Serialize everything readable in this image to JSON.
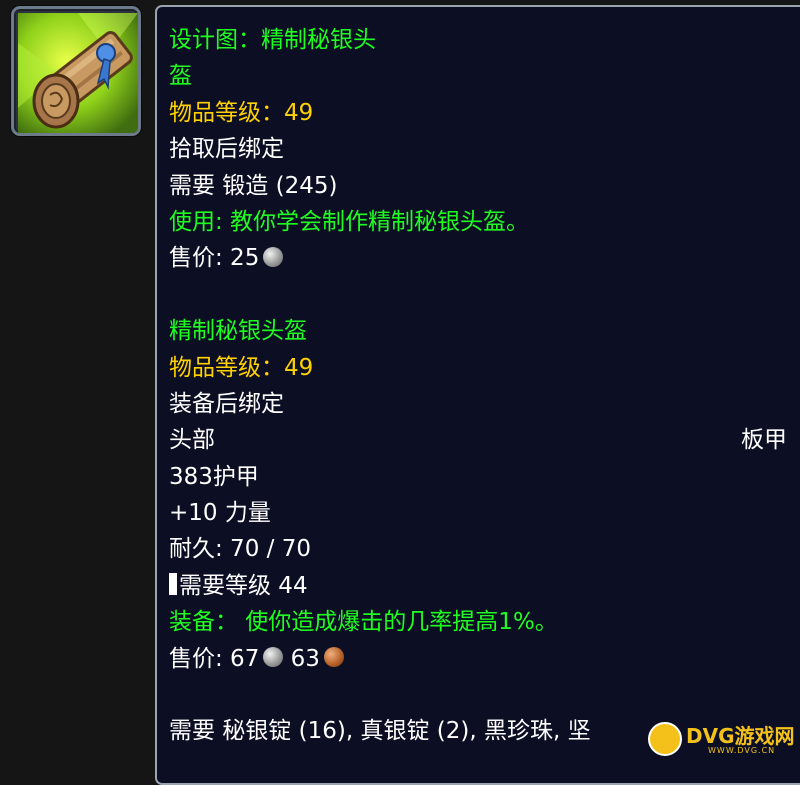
{
  "item_icon": "blueprint-scroll-icon",
  "recipe": {
    "title_line1": "设计图：精制秘银头",
    "title_line2": "盔",
    "item_level": "物品等级：49",
    "binding": "拾取后绑定",
    "requires": "需要 锻造 (245)",
    "use": "使用: 教你学会制作精制秘银头盔。",
    "sell_label": "售价: 25"
  },
  "crafted": {
    "name": "精制秘银头盔",
    "item_level": "物品等级：49",
    "binding": "装备后绑定",
    "slot": "头部",
    "armor_type": "板甲",
    "armor": "383护甲",
    "stat": "+10 力量",
    "durability": "耐久: 70 / 70",
    "required_level": "需要等级 44",
    "equip_effect": "装备： 使你造成爆击的几率提高1%。",
    "sell_label": "售价: 67",
    "sell_copper": "63"
  },
  "reagents": "需要 秘银锭 (16), 真银锭 (2), 黑珍珠, 坚",
  "watermark": {
    "text": "DVG游戏网",
    "sub": "WWW.DVG.CN"
  },
  "colors": {
    "quality_green": "#1fff1f",
    "item_level_yellow": "#ffd100",
    "tooltip_bg": "#0c0f24"
  }
}
